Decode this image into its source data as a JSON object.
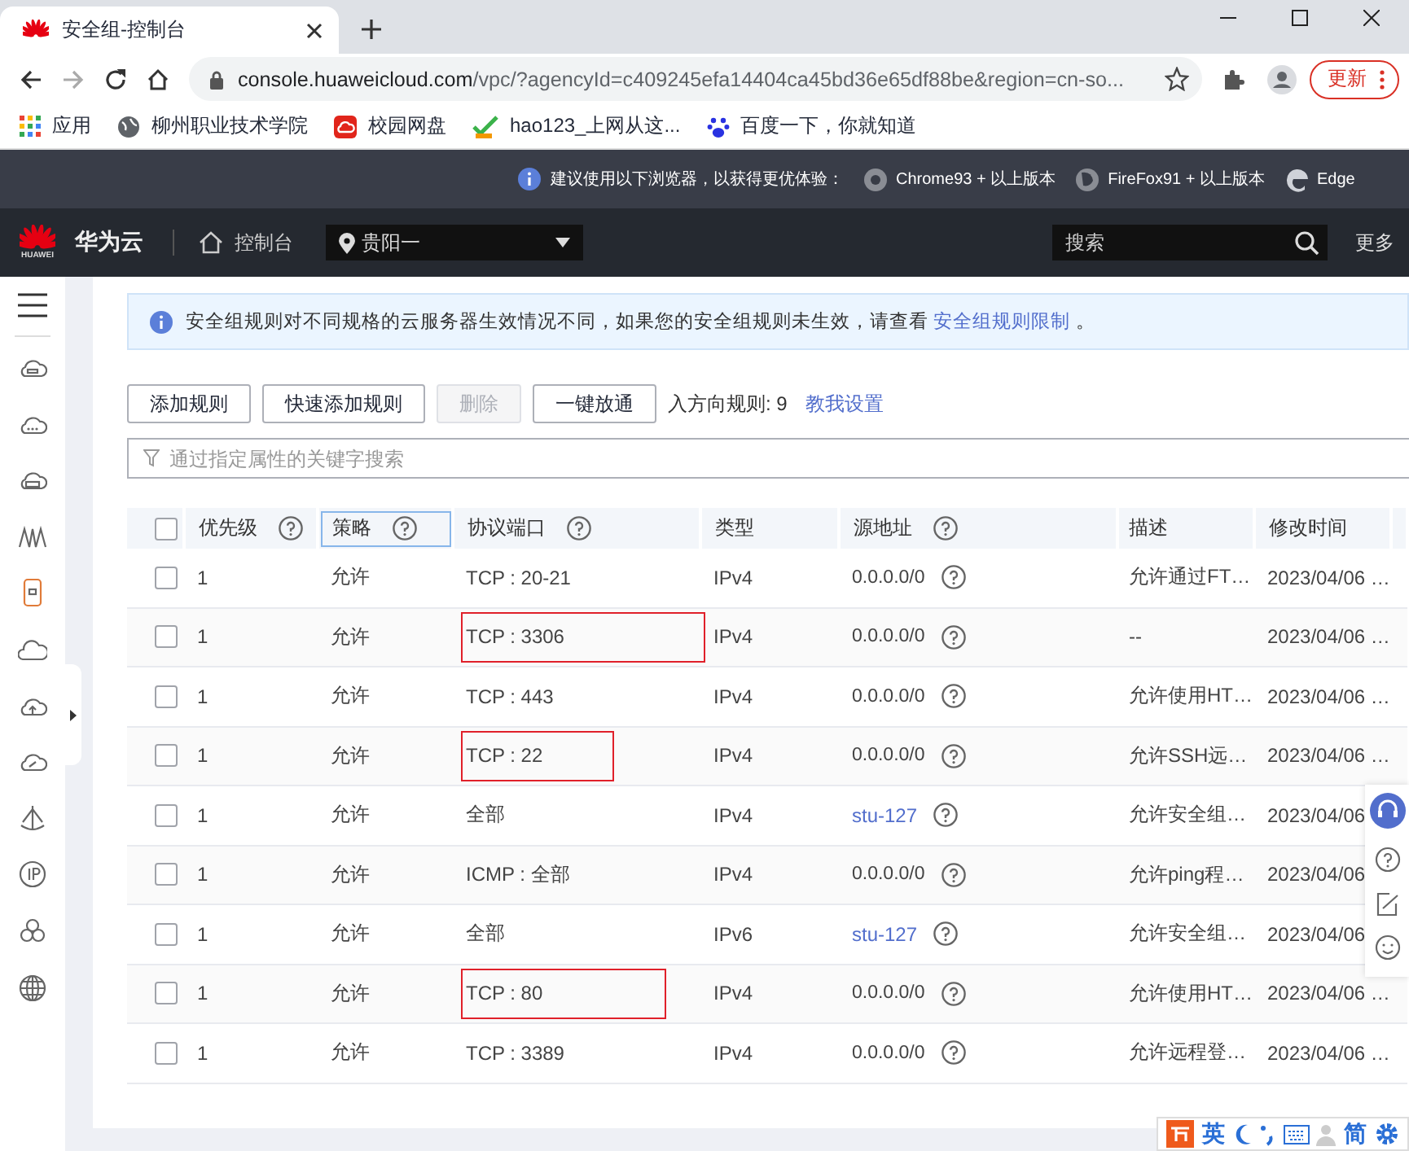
{
  "browser": {
    "tab_title": "安全组-控制台",
    "url_host": "console.huaweicloud.com",
    "url_path": "/vpc/?agencyId=c409245efa14404ca45bd36e65df88be&region=cn-so...",
    "update_button": "更新",
    "bookmarks": [
      "应用",
      "柳州职业技术学院",
      "校园网盘",
      "hao123_上网从这...",
      "百度一下，你就知道"
    ]
  },
  "browser_notice": {
    "text": "建议使用以下浏览器，以获得更优体验：",
    "browsers": [
      "Chrome93 + 以上版本",
      "FireFox91 + 以上版本",
      "Edge"
    ]
  },
  "console_header": {
    "logo_text": "HUAWEI",
    "brand": "华为云",
    "console_link": "控制台",
    "region": "贵阳一",
    "search_placeholder": "搜索",
    "more": "更多"
  },
  "notice": {
    "text": "安全组规则对不同规格的云服务器生效情况不同，如果您的安全组规则未生效，请查看",
    "link": "安全组规则限制",
    "end": "。"
  },
  "toolbar": {
    "buttons": [
      {
        "label": "添加规则",
        "disabled": false
      },
      {
        "label": "快速添加规则",
        "disabled": false
      },
      {
        "label": "删除",
        "disabled": true
      },
      {
        "label": "一键放通",
        "disabled": false
      }
    ],
    "rule_count": "入方向规则: 9",
    "help_link": "教我设置"
  },
  "filter": {
    "placeholder": "通过指定属性的关键字搜索"
  },
  "table": {
    "all_checked": false,
    "columns": [
      {
        "label": "优先级",
        "help": true,
        "focused": false
      },
      {
        "label": "策略",
        "help": true,
        "focused": true
      },
      {
        "label": "协议端口",
        "help": true,
        "focused": false
      },
      {
        "label": "类型",
        "help": false,
        "focused": false
      },
      {
        "label": "源地址",
        "help": true,
        "focused": false
      },
      {
        "label": "描述",
        "help": false,
        "focused": false
      },
      {
        "label": "修改时间",
        "help": false,
        "focused": false
      }
    ],
    "rows": [
      {
        "checked": false,
        "priority": "1",
        "action": "允许",
        "protocol": "TCP : 20-21",
        "highlighted": false,
        "type": "IPv4",
        "source": "0.0.0.0/0",
        "source_link": false,
        "description": "允许通过FT…",
        "modified": "2023/04/06 …"
      },
      {
        "checked": false,
        "priority": "1",
        "action": "允许",
        "protocol": "TCP : 3306",
        "highlighted": true,
        "type": "IPv4",
        "source": "0.0.0.0/0",
        "source_link": false,
        "description": "--",
        "modified": "2023/04/06 …"
      },
      {
        "checked": false,
        "priority": "1",
        "action": "允许",
        "protocol": "TCP : 443",
        "highlighted": false,
        "type": "IPv4",
        "source": "0.0.0.0/0",
        "source_link": false,
        "description": "允许使用HT…",
        "modified": "2023/04/06 …"
      },
      {
        "checked": false,
        "priority": "1",
        "action": "允许",
        "protocol": "TCP : 22",
        "highlighted": true,
        "type": "IPv4",
        "source": "0.0.0.0/0",
        "source_link": false,
        "description": "允许SSH远…",
        "modified": "2023/04/06 …"
      },
      {
        "checked": false,
        "priority": "1",
        "action": "允许",
        "protocol": "全部",
        "highlighted": false,
        "type": "IPv4",
        "source": "stu-127",
        "source_link": true,
        "description": "允许安全组…",
        "modified": "2023/04/06"
      },
      {
        "checked": false,
        "priority": "1",
        "action": "允许",
        "protocol": "ICMP : 全部",
        "highlighted": false,
        "type": "IPv4",
        "source": "0.0.0.0/0",
        "source_link": false,
        "description": "允许ping程…",
        "modified": "2023/04/06"
      },
      {
        "checked": false,
        "priority": "1",
        "action": "允许",
        "protocol": "全部",
        "highlighted": false,
        "type": "IPv6",
        "source": "stu-127",
        "source_link": true,
        "description": "允许安全组…",
        "modified": "2023/04/06"
      },
      {
        "checked": false,
        "priority": "1",
        "action": "允许",
        "protocol": "TCP : 80",
        "highlighted": true,
        "type": "IPv4",
        "source": "0.0.0.0/0",
        "source_link": false,
        "description": "允许使用HT…",
        "modified": "2023/04/06 …"
      },
      {
        "checked": false,
        "priority": "1",
        "action": "允许",
        "protocol": "TCP : 3389",
        "highlighted": false,
        "type": "IPv4",
        "source": "0.0.0.0/0",
        "source_link": false,
        "description": "允许远程登…",
        "modified": "2023/04/06 …"
      }
    ]
  },
  "ime_bar": {
    "items": [
      "英",
      "简"
    ]
  }
}
